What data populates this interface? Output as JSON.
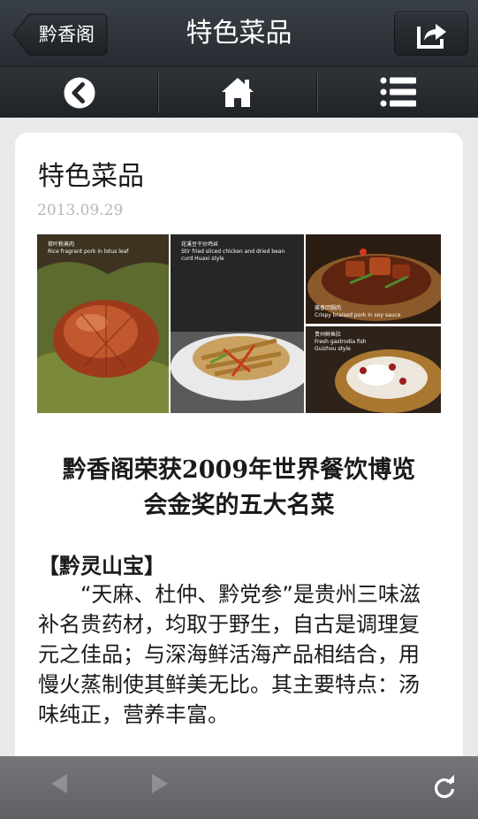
{
  "topbar": {
    "back_label": "黔香阁",
    "title": "特色菜品",
    "share_icon": "share-icon"
  },
  "navbar": {
    "items": [
      {
        "name": "back",
        "icon": "chevron-left-circle-icon"
      },
      {
        "name": "home",
        "icon": "home-icon"
      },
      {
        "name": "menu",
        "icon": "list-icon"
      }
    ]
  },
  "article": {
    "title": "特色菜品",
    "date": "2013.09.29",
    "photos": [
      {
        "caption_cn": "荷叶粉蒸肉",
        "caption_en": "Rice fragrant pork in lotus leaf"
      },
      {
        "caption_cn": "花溪豆干炒鸡丝",
        "caption_en": "Stir fried sliced chicken and dried bean curd Huaxi style"
      },
      {
        "caption_cn": "酱香回锅肉",
        "caption_en": "Crispy braised pork in soy sauce"
      },
      {
        "caption_cn": "贵州鲜鱼肚",
        "caption_en": "Fresh gastrodia fish Guizhou style"
      }
    ],
    "headline_line1": "黔香阁荣获2009年世界餐饮博览",
    "headline_line2": "会金奖的五大名菜",
    "section_title": "【黔灵山宝】",
    "body": "“天麻、杜仲、黔党参”是贵州三味滋补名贵药材，均取于野生，自古是调理复元之佳品；与深海鲜活海产品相结合，用慢火蒸制使其鲜美无比。其主要特点：汤味纯正，营养丰富。"
  },
  "bottombar": {
    "back_icon": "arrow-left-icon",
    "forward_icon": "arrow-right-icon",
    "refresh_icon": "refresh-icon"
  },
  "colors": {
    "topbar": "#2c3137",
    "page_bg": "#e9e9e9",
    "card_bg": "#ffffff",
    "bottombar": "#6a6c6f"
  }
}
